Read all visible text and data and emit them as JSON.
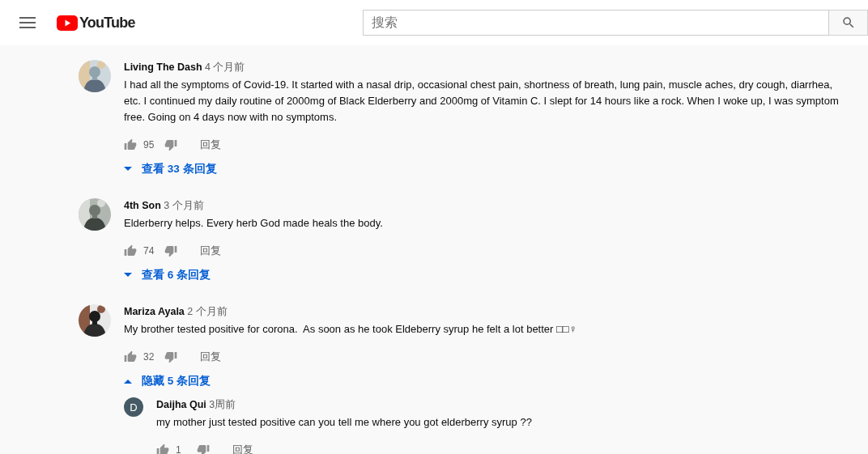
{
  "header": {
    "logo_text": "YouTube",
    "search": {
      "placeholder": "搜索"
    }
  },
  "comments": [
    {
      "author": "Living The Dash",
      "time": "4 个月前",
      "text": "I had all the symptoms of Covid-19. It started with a nasal drip, occasional chest pain, shortness of breath, lung pain, muscle aches, dry cough, diarrhea, etc. I continued my daily routine of 2000mg of Black Elderberry and 2000mg of Vitamin C. I slept for 14 hours like a rock. When I woke up, I was symptom free. Going on 4 days now with no symptoms.",
      "likes": "95",
      "reply": "回复",
      "replies_toggle": {
        "label": "查看 33 条回复",
        "expanded": false
      }
    },
    {
      "author": "4th Son",
      "time": "3 个月前",
      "text": "Elderberry helps. Every herb God made heals the body.",
      "likes": "74",
      "reply": "回复",
      "replies_toggle": {
        "label": "查看 6 条回复",
        "expanded": false
      }
    },
    {
      "author": "Mariza Ayala",
      "time": "2 个月前",
      "text": "My brother tested positive for corona.  As soon as he took Eldeberry syrup he felt a lot better □□♀",
      "likes": "32",
      "reply": "回复",
      "replies_toggle": {
        "label": "隐藏 5 条回复",
        "expanded": true
      },
      "replies": [
        {
          "author": "Daijha Qui",
          "time": "3周前",
          "avatar": {
            "kind": "letter",
            "letter": "D"
          },
          "text": "my mother just tested positive can you tell me where you got elderberry syrup ??",
          "likes": "1",
          "reply": "回复"
        }
      ]
    }
  ]
}
